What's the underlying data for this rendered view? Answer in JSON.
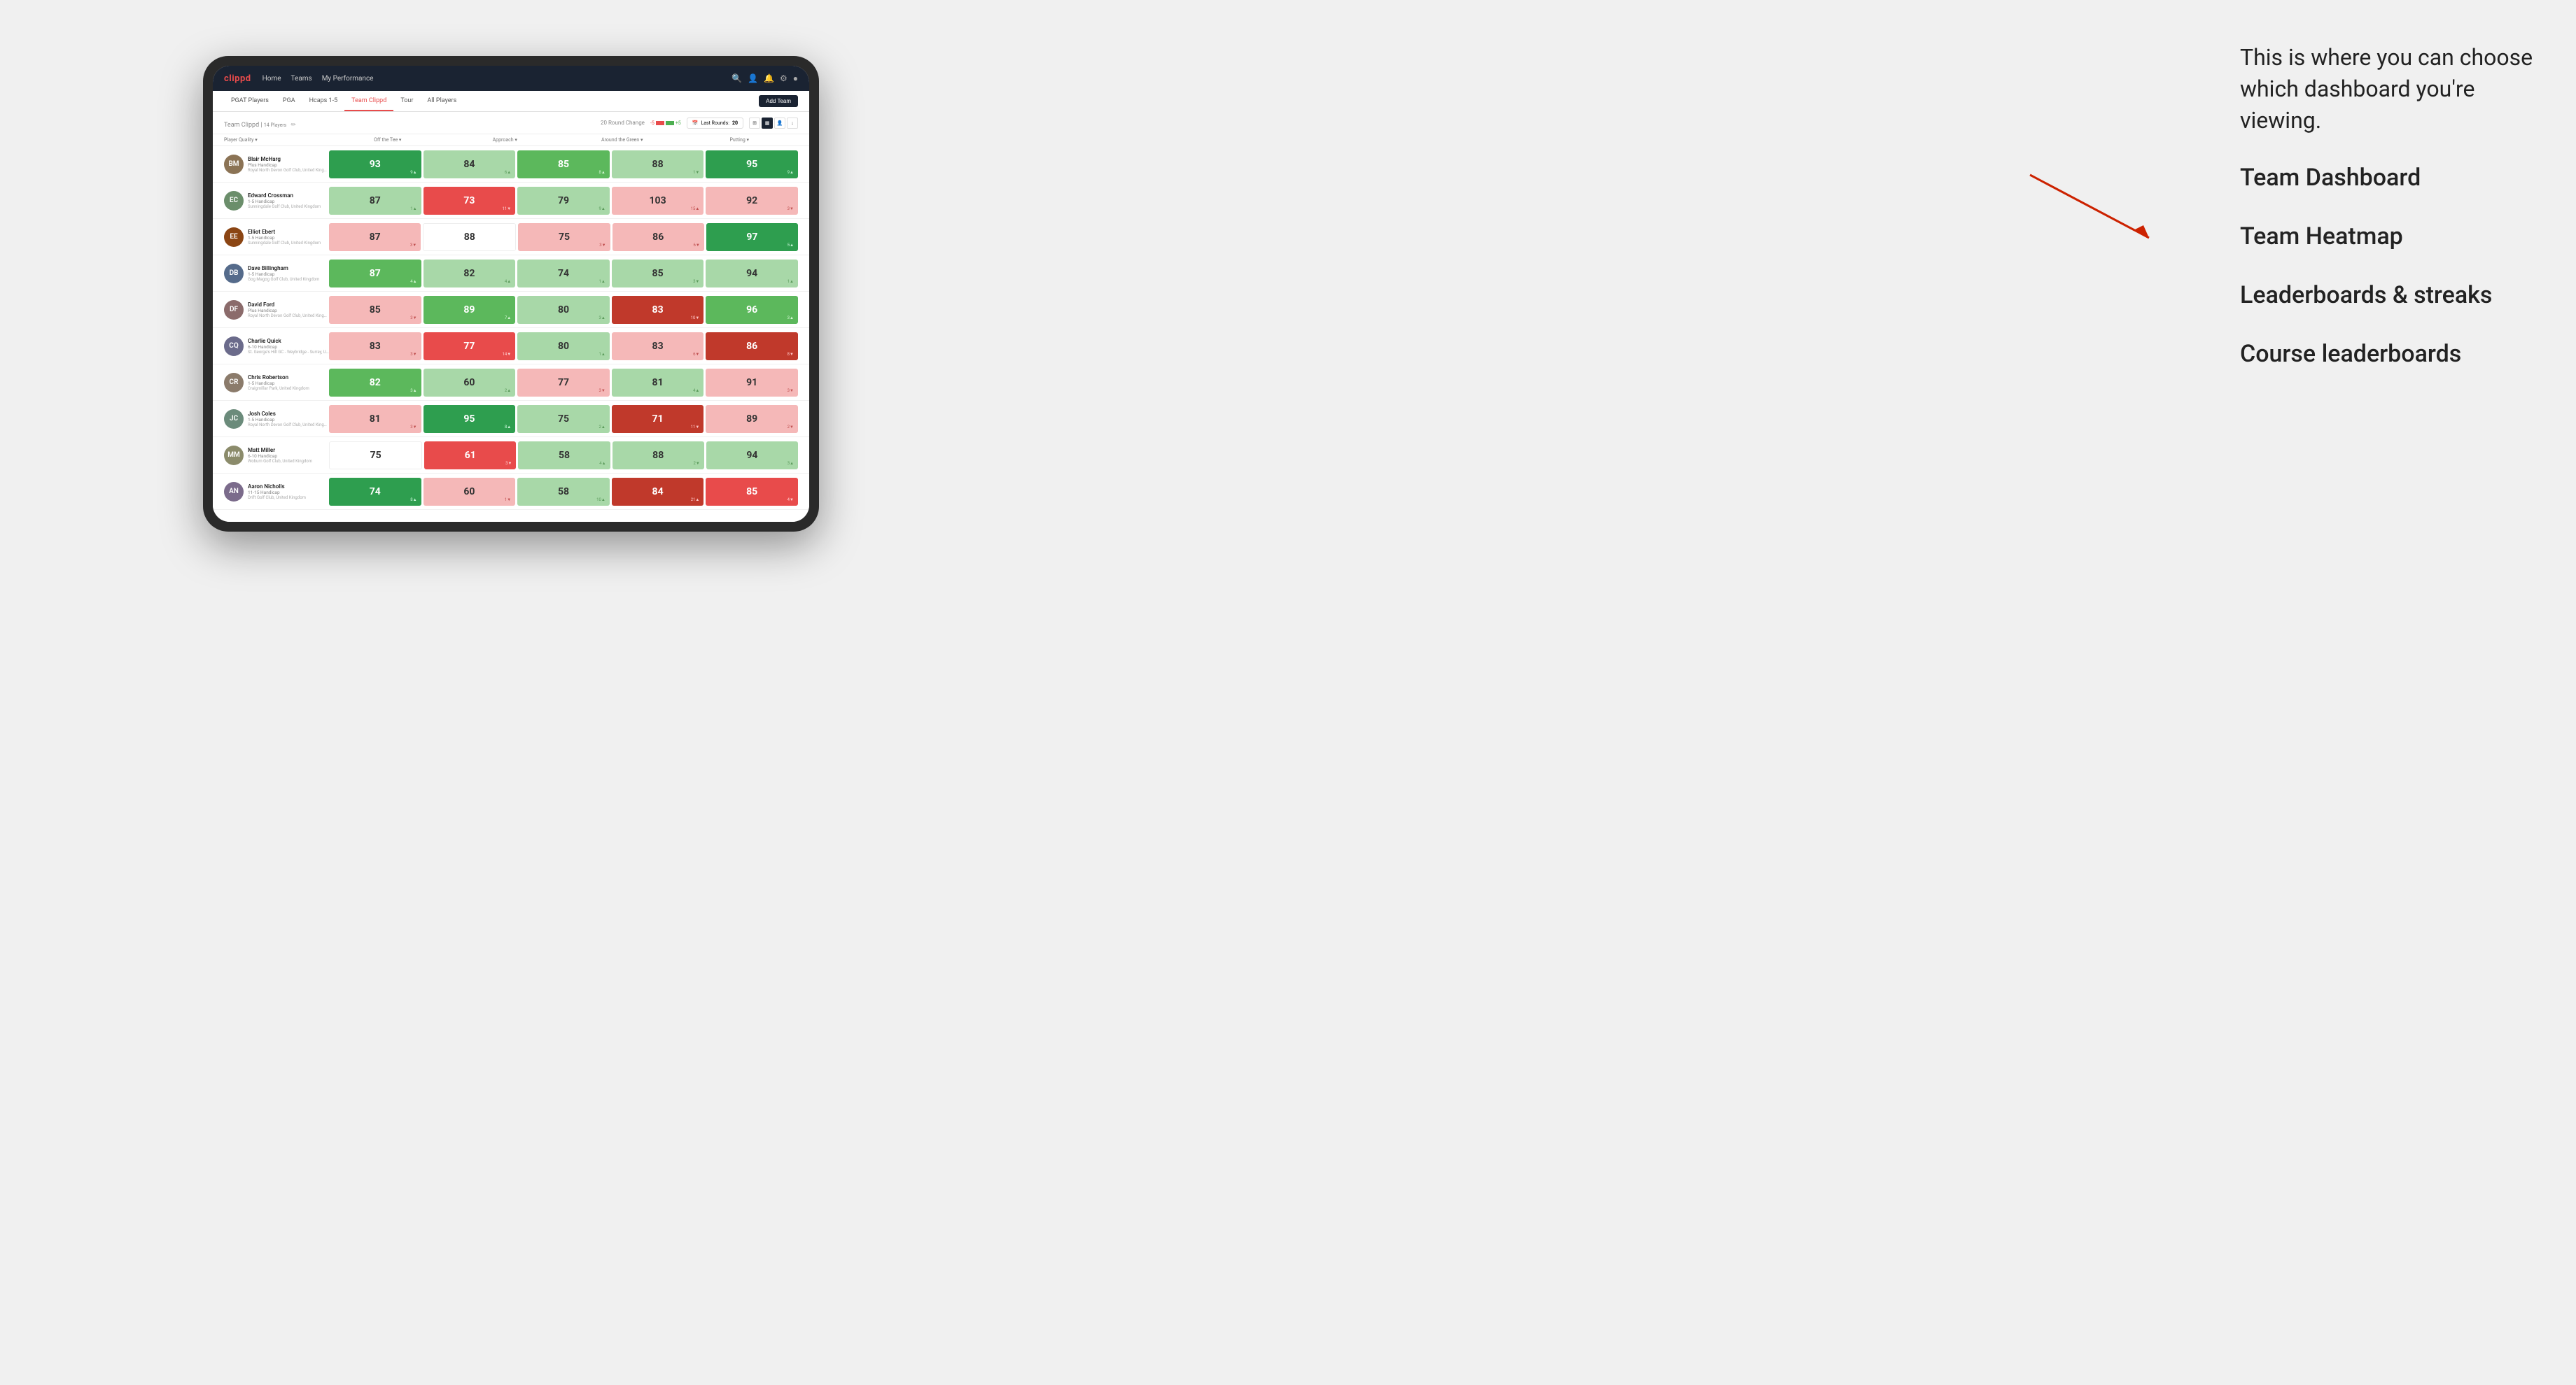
{
  "annotation": {
    "intro": "This is where you can choose which dashboard you're viewing.",
    "options": [
      "Team Dashboard",
      "Team Heatmap",
      "Leaderboards & streaks",
      "Course leaderboards"
    ]
  },
  "nav": {
    "logo": "clippd",
    "links": [
      "Home",
      "Teams",
      "My Performance"
    ],
    "icons": [
      "search",
      "person",
      "bell",
      "settings",
      "user-circle"
    ]
  },
  "subnav": {
    "links": [
      "PGAT Players",
      "PGA",
      "Hcaps 1-5",
      "Team Clippd",
      "Tour",
      "All Players"
    ],
    "active": "Team Clippd",
    "add_button": "Add Team"
  },
  "team_header": {
    "title": "Team Clippd",
    "player_count": "14 Players",
    "round_change_label": "20 Round Change",
    "round_change_neg": "-5",
    "round_change_pos": "+5",
    "last_rounds_label": "Last Rounds:",
    "last_rounds_value": "20"
  },
  "table": {
    "columns": [
      "Player Quality ▾",
      "Off the Tee ▾",
      "Approach ▾",
      "Around the Green ▾",
      "Putting ▾"
    ],
    "rows": [
      {
        "name": "Blair McHarg",
        "handicap": "Plus Handicap",
        "club": "Royal North Devon Golf Club, United Kingdom",
        "avatar_initials": "BM",
        "avatar_class": "av-0",
        "metrics": [
          {
            "value": "93",
            "change": "9▲",
            "bg": "bg-green-strong"
          },
          {
            "value": "84",
            "change": "6▲",
            "bg": "bg-green-light"
          },
          {
            "value": "85",
            "change": "8▲",
            "bg": "bg-green-mid"
          },
          {
            "value": "88",
            "change": "1▼",
            "bg": "bg-green-light"
          },
          {
            "value": "95",
            "change": "9▲",
            "bg": "bg-green-strong"
          }
        ]
      },
      {
        "name": "Edward Crossman",
        "handicap": "1-5 Handicap",
        "club": "Sunningdale Golf Club, United Kingdom",
        "avatar_initials": "EC",
        "avatar_class": "av-1",
        "metrics": [
          {
            "value": "87",
            "change": "1▲",
            "bg": "bg-green-light"
          },
          {
            "value": "73",
            "change": "11▼",
            "bg": "bg-red-mid"
          },
          {
            "value": "79",
            "change": "9▲",
            "bg": "bg-green-light"
          },
          {
            "value": "103",
            "change": "15▲",
            "bg": "bg-red-light"
          },
          {
            "value": "92",
            "change": "3▼",
            "bg": "bg-red-light"
          }
        ]
      },
      {
        "name": "Elliot Ebert",
        "handicap": "1-5 Handicap",
        "club": "Sunningdale Golf Club, United Kingdom",
        "avatar_initials": "EE",
        "avatar_class": "av-2",
        "metrics": [
          {
            "value": "87",
            "change": "3▼",
            "bg": "bg-red-light"
          },
          {
            "value": "88",
            "change": "",
            "bg": "bg-white"
          },
          {
            "value": "75",
            "change": "3▼",
            "bg": "bg-red-light"
          },
          {
            "value": "86",
            "change": "6▼",
            "bg": "bg-red-light"
          },
          {
            "value": "97",
            "change": "5▲",
            "bg": "bg-green-strong"
          }
        ]
      },
      {
        "name": "Dave Billingham",
        "handicap": "1-5 Handicap",
        "club": "Gog Magog Golf Club, United Kingdom",
        "avatar_initials": "DB",
        "avatar_class": "av-3",
        "metrics": [
          {
            "value": "87",
            "change": "4▲",
            "bg": "bg-green-mid"
          },
          {
            "value": "82",
            "change": "4▲",
            "bg": "bg-green-light"
          },
          {
            "value": "74",
            "change": "1▲",
            "bg": "bg-green-light"
          },
          {
            "value": "85",
            "change": "3▼",
            "bg": "bg-green-light"
          },
          {
            "value": "94",
            "change": "1▲",
            "bg": "bg-green-light"
          }
        ]
      },
      {
        "name": "David Ford",
        "handicap": "Plus Handicap",
        "club": "Royal North Devon Golf Club, United Kingdom",
        "avatar_initials": "DF",
        "avatar_class": "av-4",
        "metrics": [
          {
            "value": "85",
            "change": "3▼",
            "bg": "bg-red-light"
          },
          {
            "value": "89",
            "change": "7▲",
            "bg": "bg-green-mid"
          },
          {
            "value": "80",
            "change": "3▲",
            "bg": "bg-green-light"
          },
          {
            "value": "83",
            "change": "10▼",
            "bg": "bg-red-strong"
          },
          {
            "value": "96",
            "change": "3▲",
            "bg": "bg-green-mid"
          }
        ]
      },
      {
        "name": "Charlie Quick",
        "handicap": "6-10 Handicap",
        "club": "St. George's Hill GC - Weybridge - Surrey, Uni...",
        "avatar_initials": "CQ",
        "avatar_class": "av-5",
        "metrics": [
          {
            "value": "83",
            "change": "3▼",
            "bg": "bg-red-light"
          },
          {
            "value": "77",
            "change": "14▼",
            "bg": "bg-red-mid"
          },
          {
            "value": "80",
            "change": "1▲",
            "bg": "bg-green-light"
          },
          {
            "value": "83",
            "change": "6▼",
            "bg": "bg-red-light"
          },
          {
            "value": "86",
            "change": "8▼",
            "bg": "bg-red-strong"
          }
        ]
      },
      {
        "name": "Chris Robertson",
        "handicap": "1-5 Handicap",
        "club": "Craigmillar Park, United Kingdom",
        "avatar_initials": "CR",
        "avatar_class": "av-6",
        "metrics": [
          {
            "value": "82",
            "change": "3▲",
            "bg": "bg-green-mid"
          },
          {
            "value": "60",
            "change": "2▲",
            "bg": "bg-green-light"
          },
          {
            "value": "77",
            "change": "3▼",
            "bg": "bg-red-light"
          },
          {
            "value": "81",
            "change": "4▲",
            "bg": "bg-green-light"
          },
          {
            "value": "91",
            "change": "3▼",
            "bg": "bg-red-light"
          }
        ]
      },
      {
        "name": "Josh Coles",
        "handicap": "1-5 Handicap",
        "club": "Royal North Devon Golf Club, United Kingdom",
        "avatar_initials": "JC",
        "avatar_class": "av-7",
        "metrics": [
          {
            "value": "81",
            "change": "3▼",
            "bg": "bg-red-light"
          },
          {
            "value": "95",
            "change": "8▲",
            "bg": "bg-green-strong"
          },
          {
            "value": "75",
            "change": "2▲",
            "bg": "bg-green-light"
          },
          {
            "value": "71",
            "change": "11▼",
            "bg": "bg-red-strong"
          },
          {
            "value": "89",
            "change": "2▼",
            "bg": "bg-red-light"
          }
        ]
      },
      {
        "name": "Matt Miller",
        "handicap": "6-10 Handicap",
        "club": "Woburn Golf Club, United Kingdom",
        "avatar_initials": "MM",
        "avatar_class": "av-8",
        "metrics": [
          {
            "value": "75",
            "change": "",
            "bg": "bg-white"
          },
          {
            "value": "61",
            "change": "3▼",
            "bg": "bg-red-mid"
          },
          {
            "value": "58",
            "change": "4▲",
            "bg": "bg-green-light"
          },
          {
            "value": "88",
            "change": "2▼",
            "bg": "bg-green-light"
          },
          {
            "value": "94",
            "change": "3▲",
            "bg": "bg-green-light"
          }
        ]
      },
      {
        "name": "Aaron Nicholls",
        "handicap": "11-15 Handicap",
        "club": "Drift Golf Club, United Kingdom",
        "avatar_initials": "AN",
        "avatar_class": "av-9",
        "metrics": [
          {
            "value": "74",
            "change": "8▲",
            "bg": "bg-green-strong"
          },
          {
            "value": "60",
            "change": "1▼",
            "bg": "bg-red-light"
          },
          {
            "value": "58",
            "change": "10▲",
            "bg": "bg-green-light"
          },
          {
            "value": "84",
            "change": "21▲",
            "bg": "bg-red-strong"
          },
          {
            "value": "85",
            "change": "4▼",
            "bg": "bg-red-mid"
          }
        ]
      }
    ]
  }
}
